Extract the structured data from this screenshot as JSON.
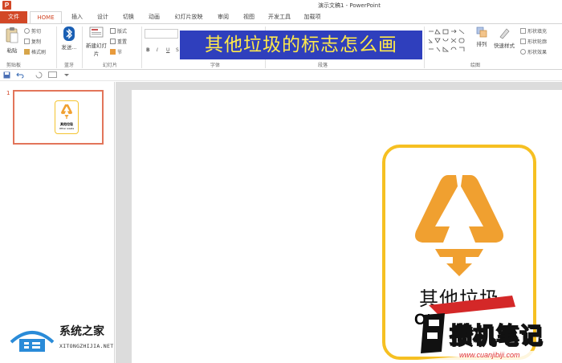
{
  "titlebar": {
    "app_icon": "P",
    "title": "演示文稿1 - PowerPoint"
  },
  "tabs": [
    "文件",
    "HOME",
    "插入",
    "设计",
    "切换",
    "动画",
    "幻灯片放映",
    "审阅",
    "视图",
    "开发工具",
    "加载项"
  ],
  "ribbon": {
    "clipboard": {
      "paste": "粘贴",
      "cut": "剪切",
      "copy": "复制",
      "format_painter": "格式刷",
      "label": "剪贴板"
    },
    "bluetooth": {
      "send": "发送...",
      "label": "蓝牙"
    },
    "slides": {
      "new_slide": "新建幻灯片",
      "layout": "版式",
      "reset": "重置",
      "section": "节",
      "label": "幻灯片"
    },
    "font": {
      "label": "字体",
      "bold": "B",
      "italic": "I",
      "underline": "U",
      "strike": "S"
    },
    "paragraph": {
      "label": "段落"
    },
    "drawing": {
      "arrange": "排列",
      "quick_styles": "快速样式",
      "shape_fill": "形状填充",
      "shape_outline": "形状轮廓",
      "shape_effects": "形状效果",
      "label": "绘图"
    }
  },
  "banner": {
    "text": "其他垃圾的标志怎么画"
  },
  "slides_pane": {
    "number": "1",
    "thumb_zh": "其他垃圾",
    "thumb_en": "Other waste"
  },
  "slide": {
    "title_zh": "其他垃圾",
    "title_en": "Ot"
  },
  "watermarks": {
    "left_name": "系统之家",
    "left_url": "XITONGZHIJIA.NET",
    "right_name": "攒机笔记",
    "right_url": "www.cuanjibiji.com"
  },
  "colors": {
    "accent": "#d24726",
    "icon_orange": "#f0a030",
    "card_border": "#f6c022",
    "banner_bg": "#2f3fbd",
    "banner_text": "#ffe94a"
  }
}
